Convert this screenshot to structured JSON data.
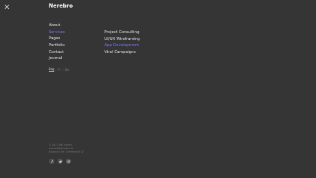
{
  "brand": {
    "logo_text": "Nerebro"
  },
  "close": {
    "icon": "close-icon"
  },
  "main_menu": [
    {
      "label": "About",
      "active": false
    },
    {
      "label": "Services",
      "active": true
    },
    {
      "label": "Pages",
      "active": false
    },
    {
      "label": "Portfolio",
      "active": false
    },
    {
      "label": "Contact",
      "active": false
    },
    {
      "label": "Journal",
      "active": false
    }
  ],
  "sub_menu": [
    {
      "label": "Project Consulting",
      "active": false
    },
    {
      "label": "UI/UX Wireframing",
      "active": false
    },
    {
      "label": "App Development",
      "active": true
    },
    {
      "label": "Viral Campaigns",
      "active": false
    }
  ],
  "languages": [
    {
      "label": "Eng",
      "current": true
    },
    {
      "label": "Fr",
      "current": false
    },
    {
      "label": "De",
      "current": false
    }
  ],
  "footer": {
    "lines": [
      "© 2017 NB Theme",
      "contact@nerebro.io",
      "Brooklyn, NY, Greenpoint 12"
    ]
  },
  "socials": [
    {
      "icon": "facebook-icon"
    },
    {
      "icon": "twitter-icon"
    },
    {
      "icon": "instagram-icon"
    }
  ],
  "colors": {
    "background": "#353535",
    "accent": "#7b79f0",
    "text": "#e8e8e8"
  }
}
